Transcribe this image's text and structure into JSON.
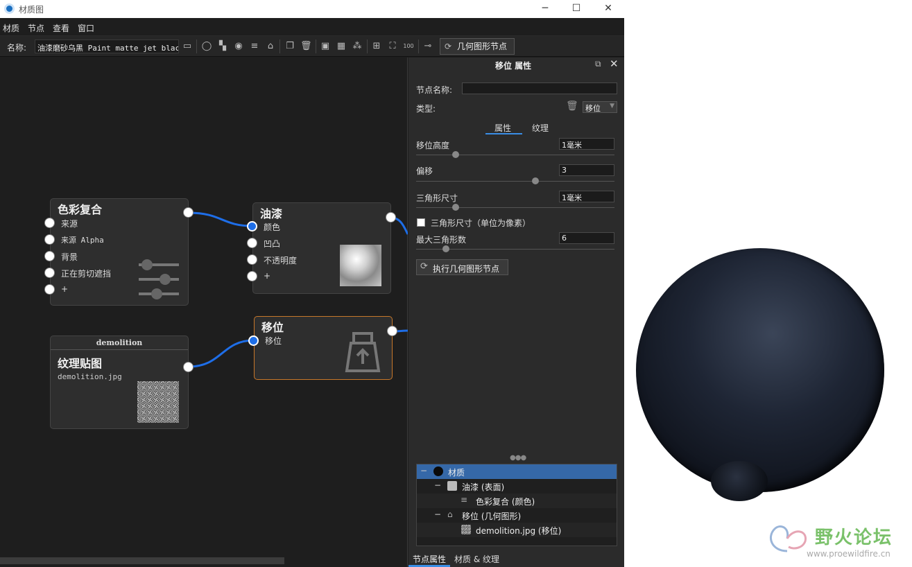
{
  "window": {
    "title": "材质图",
    "min": "─",
    "max": "☐",
    "close": "✕"
  },
  "menu": [
    "材质",
    "节点",
    "查看",
    "窗口"
  ],
  "toolbar": {
    "name_label": "名称:",
    "name_value": "油漆磨砂乌黑 Paint matte jet black",
    "geo_button": "几何图形节点"
  },
  "nodes": {
    "color_composite": {
      "title": "色彩复合",
      "ports": [
        "来源",
        "来源 Alpha",
        "背景",
        "正在剪切遮挡",
        "+"
      ]
    },
    "paint": {
      "title": "油漆",
      "ports": [
        "颜色",
        "凹凸",
        "不透明度",
        "+"
      ]
    },
    "texture": {
      "header": "demolition",
      "title": "纹理贴图",
      "file": "demolition.jpg"
    },
    "displace": {
      "title": "移位",
      "port": "移位"
    }
  },
  "props": {
    "header": "移位 属性",
    "node_name_label": "节点名称:",
    "node_name_value": "",
    "type_label": "类型:",
    "type_value": "移位",
    "tab_attr": "属性",
    "tab_texture": "纹理",
    "height_label": "移位高度",
    "height_value": "1毫米",
    "height_level": 0.2,
    "offset_label": "偏移",
    "offset_value": "3",
    "offset_level": 0.6,
    "tri_label": "三角形尺寸",
    "tri_value": "1毫米",
    "tri_level": 0.2,
    "pixel_checkbox_label": "三角形尺寸（单位为像素）",
    "pixel_checked": false,
    "max_tri_label": "最大三角形数",
    "max_tri_value": "6",
    "max_tri_level": 0.15,
    "exec_button": "执行几何图形节点"
  },
  "tree": [
    "材质",
    "油漆 (表面)",
    "色彩复合 (颜色)",
    "移位 (几何图形)",
    "demolition.jpg (移位)"
  ],
  "bottom_tabs": [
    "节点属性",
    "材质 & 纹理"
  ],
  "watermark": {
    "text": "野火论坛",
    "url": "www.proewildfire.cn"
  }
}
